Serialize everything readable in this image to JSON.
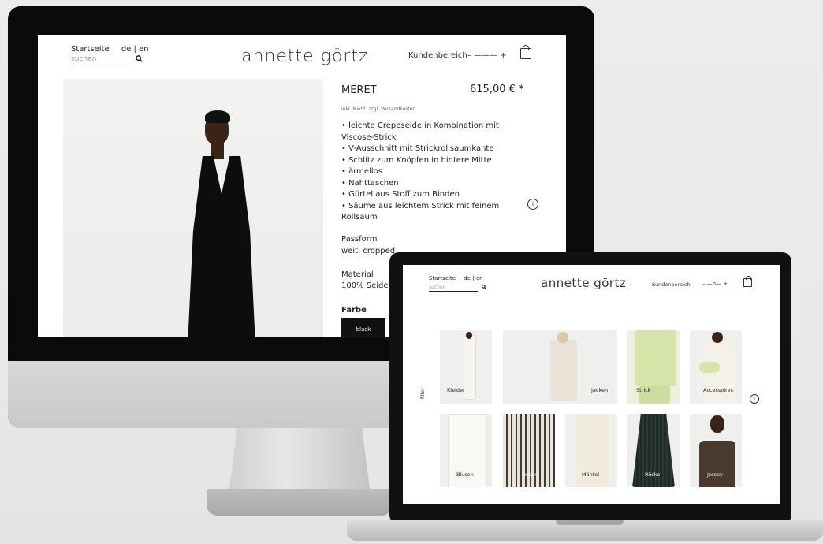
{
  "desktop": {
    "nav": {
      "home": "Startseite",
      "lang": "de | en",
      "search_placeholder": "suchen",
      "logo": "annette görtz",
      "account": "Kundenbereich",
      "zoom": "– ——— +"
    },
    "product": {
      "name": "MERET",
      "price": "615,00 € *",
      "tax_note": "inkl. MwSt. zzgl. Versandkosten",
      "features": [
        "• leichte Crepeseide in Kombination mit",
        "Viscose-Strick",
        "• V-Ausschnitt mit Strickrollsaumkante",
        "• Schlitz zum Knöpfen in hintere Mitte",
        "• ärmellos",
        "• Nahttaschen",
        "• Gürtel aus Stoff zum Binden",
        "• Säume aus leichtem Strick mit feinem",
        "Rollsaum"
      ],
      "fit_heading": "Passform",
      "fit_value": "weit, cropped",
      "material_heading": "Material",
      "material_value": "100% Seide",
      "color_heading": "Farbe",
      "color_option": "black"
    }
  },
  "laptop": {
    "nav": {
      "home": "Startseite",
      "lang": "de | en",
      "search_placeholder": "suchen",
      "logo": "annette görtz",
      "account": "Kundenbereich",
      "zoom": "– —o— +"
    },
    "filter_label": "filter",
    "categories": [
      {
        "label": "Kleider"
      },
      {
        "label": "Jacken"
      },
      {
        "label": "Strick"
      },
      {
        "label": "Accessoires"
      },
      {
        "label": "Blusen"
      },
      {
        "label": "Hosen"
      },
      {
        "label": "Mäntel"
      },
      {
        "label": "Röcke"
      },
      {
        "label": "Jersey"
      }
    ]
  },
  "icons": {
    "info": "i",
    "search": "⌕"
  }
}
